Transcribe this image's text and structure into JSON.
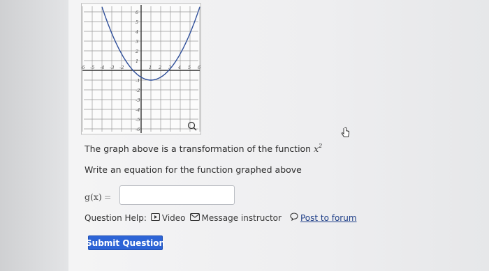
{
  "graph": {
    "x_ticks": [
      "-6",
      "-5",
      "-4",
      "-3",
      "-2",
      "1",
      "2",
      "3",
      "4",
      "5",
      "6"
    ],
    "y_ticks": [
      "6",
      "5",
      "4",
      "3",
      "2",
      "1",
      "-1",
      "-2",
      "-3",
      "-4",
      "-5",
      "-6"
    ],
    "zoom_icon": "magnifier-icon"
  },
  "question": {
    "prompt_text": "The graph above is a transformation of the function",
    "prompt_func": "x",
    "prompt_exp": "2",
    "instruction": "Write an equation for the function graphed above",
    "fn_label": "g(x)",
    "fn_eq": "=",
    "answer_value": ""
  },
  "help": {
    "label": "Question Help:",
    "video": "Video",
    "message": "Message instructor",
    "forum": "Post to forum"
  },
  "submit_label": "Submit Question",
  "colors": {
    "submit_bg": "#2d64d6",
    "link": "#1f3f88"
  }
}
